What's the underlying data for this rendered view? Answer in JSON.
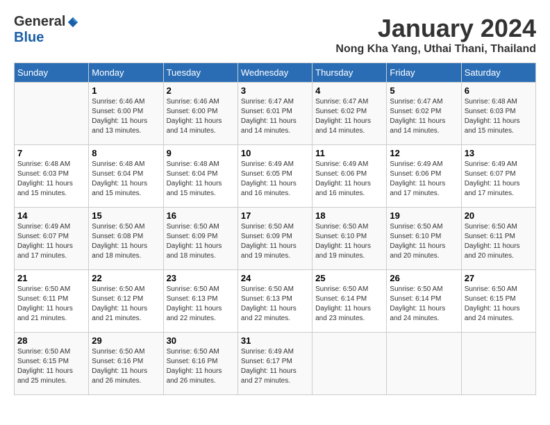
{
  "header": {
    "logo": {
      "general": "General",
      "blue": "Blue"
    },
    "title": "January 2024",
    "location": "Nong Kha Yang, Uthai Thani, Thailand"
  },
  "calendar": {
    "days_of_week": [
      "Sunday",
      "Monday",
      "Tuesday",
      "Wednesday",
      "Thursday",
      "Friday",
      "Saturday"
    ],
    "weeks": [
      [
        {
          "day": "",
          "info": ""
        },
        {
          "day": "1",
          "info": "Sunrise: 6:46 AM\nSunset: 6:00 PM\nDaylight: 11 hours\nand 13 minutes."
        },
        {
          "day": "2",
          "info": "Sunrise: 6:46 AM\nSunset: 6:00 PM\nDaylight: 11 hours\nand 14 minutes."
        },
        {
          "day": "3",
          "info": "Sunrise: 6:47 AM\nSunset: 6:01 PM\nDaylight: 11 hours\nand 14 minutes."
        },
        {
          "day": "4",
          "info": "Sunrise: 6:47 AM\nSunset: 6:02 PM\nDaylight: 11 hours\nand 14 minutes."
        },
        {
          "day": "5",
          "info": "Sunrise: 6:47 AM\nSunset: 6:02 PM\nDaylight: 11 hours\nand 14 minutes."
        },
        {
          "day": "6",
          "info": "Sunrise: 6:48 AM\nSunset: 6:03 PM\nDaylight: 11 hours\nand 15 minutes."
        }
      ],
      [
        {
          "day": "7",
          "info": "Sunrise: 6:48 AM\nSunset: 6:03 PM\nDaylight: 11 hours\nand 15 minutes."
        },
        {
          "day": "8",
          "info": "Sunrise: 6:48 AM\nSunset: 6:04 PM\nDaylight: 11 hours\nand 15 minutes."
        },
        {
          "day": "9",
          "info": "Sunrise: 6:48 AM\nSunset: 6:04 PM\nDaylight: 11 hours\nand 15 minutes."
        },
        {
          "day": "10",
          "info": "Sunrise: 6:49 AM\nSunset: 6:05 PM\nDaylight: 11 hours\nand 16 minutes."
        },
        {
          "day": "11",
          "info": "Sunrise: 6:49 AM\nSunset: 6:06 PM\nDaylight: 11 hours\nand 16 minutes."
        },
        {
          "day": "12",
          "info": "Sunrise: 6:49 AM\nSunset: 6:06 PM\nDaylight: 11 hours\nand 17 minutes."
        },
        {
          "day": "13",
          "info": "Sunrise: 6:49 AM\nSunset: 6:07 PM\nDaylight: 11 hours\nand 17 minutes."
        }
      ],
      [
        {
          "day": "14",
          "info": "Sunrise: 6:49 AM\nSunset: 6:07 PM\nDaylight: 11 hours\nand 17 minutes."
        },
        {
          "day": "15",
          "info": "Sunrise: 6:50 AM\nSunset: 6:08 PM\nDaylight: 11 hours\nand 18 minutes."
        },
        {
          "day": "16",
          "info": "Sunrise: 6:50 AM\nSunset: 6:09 PM\nDaylight: 11 hours\nand 18 minutes."
        },
        {
          "day": "17",
          "info": "Sunrise: 6:50 AM\nSunset: 6:09 PM\nDaylight: 11 hours\nand 19 minutes."
        },
        {
          "day": "18",
          "info": "Sunrise: 6:50 AM\nSunset: 6:10 PM\nDaylight: 11 hours\nand 19 minutes."
        },
        {
          "day": "19",
          "info": "Sunrise: 6:50 AM\nSunset: 6:10 PM\nDaylight: 11 hours\nand 20 minutes."
        },
        {
          "day": "20",
          "info": "Sunrise: 6:50 AM\nSunset: 6:11 PM\nDaylight: 11 hours\nand 20 minutes."
        }
      ],
      [
        {
          "day": "21",
          "info": "Sunrise: 6:50 AM\nSunset: 6:11 PM\nDaylight: 11 hours\nand 21 minutes."
        },
        {
          "day": "22",
          "info": "Sunrise: 6:50 AM\nSunset: 6:12 PM\nDaylight: 11 hours\nand 21 minutes."
        },
        {
          "day": "23",
          "info": "Sunrise: 6:50 AM\nSunset: 6:13 PM\nDaylight: 11 hours\nand 22 minutes."
        },
        {
          "day": "24",
          "info": "Sunrise: 6:50 AM\nSunset: 6:13 PM\nDaylight: 11 hours\nand 22 minutes."
        },
        {
          "day": "25",
          "info": "Sunrise: 6:50 AM\nSunset: 6:14 PM\nDaylight: 11 hours\nand 23 minutes."
        },
        {
          "day": "26",
          "info": "Sunrise: 6:50 AM\nSunset: 6:14 PM\nDaylight: 11 hours\nand 24 minutes."
        },
        {
          "day": "27",
          "info": "Sunrise: 6:50 AM\nSunset: 6:15 PM\nDaylight: 11 hours\nand 24 minutes."
        }
      ],
      [
        {
          "day": "28",
          "info": "Sunrise: 6:50 AM\nSunset: 6:15 PM\nDaylight: 11 hours\nand 25 minutes."
        },
        {
          "day": "29",
          "info": "Sunrise: 6:50 AM\nSunset: 6:16 PM\nDaylight: 11 hours\nand 26 minutes."
        },
        {
          "day": "30",
          "info": "Sunrise: 6:50 AM\nSunset: 6:16 PM\nDaylight: 11 hours\nand 26 minutes."
        },
        {
          "day": "31",
          "info": "Sunrise: 6:49 AM\nSunset: 6:17 PM\nDaylight: 11 hours\nand 27 minutes."
        },
        {
          "day": "",
          "info": ""
        },
        {
          "day": "",
          "info": ""
        },
        {
          "day": "",
          "info": ""
        }
      ]
    ]
  }
}
